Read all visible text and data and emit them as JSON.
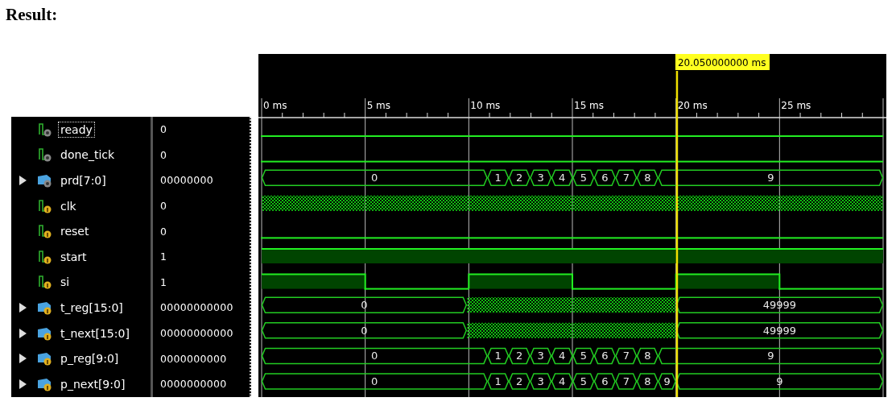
{
  "heading": "Result:",
  "time_axis": {
    "ticks": [
      {
        "label": "0 ms"
      },
      {
        "label": "5 ms"
      },
      {
        "label": "10 ms"
      },
      {
        "label": "15 ms"
      },
      {
        "label": "20 ms"
      },
      {
        "label": "25 ms"
      }
    ]
  },
  "cursor": {
    "label": "20.050000000 ms"
  },
  "signals": [
    {
      "name": "ready",
      "value": "0",
      "kind": "bit",
      "output": true,
      "selected": true,
      "segments": [
        {
          "high": false
        }
      ]
    },
    {
      "name": "done_tick",
      "value": "0",
      "kind": "bit",
      "output": true,
      "selected": false,
      "segments": [
        {
          "high": false
        }
      ]
    },
    {
      "name": "prd[7:0]",
      "value": "00000000",
      "kind": "bus",
      "output": true,
      "selected": false,
      "expanded": false,
      "segments": [
        {
          "kind": "value",
          "value": "0"
        },
        {
          "kind": "value",
          "value": "1"
        },
        {
          "kind": "value",
          "value": "2"
        },
        {
          "kind": "value",
          "value": "3"
        },
        {
          "kind": "value",
          "value": "4"
        },
        {
          "kind": "value",
          "value": "5"
        },
        {
          "kind": "value",
          "value": "6"
        },
        {
          "kind": "value",
          "value": "7"
        },
        {
          "kind": "value",
          "value": "8"
        },
        {
          "kind": "value",
          "value": "9"
        }
      ]
    },
    {
      "name": "clk",
      "value": "0",
      "kind": "clock",
      "output": false,
      "selected": false
    },
    {
      "name": "reset",
      "value": "0",
      "kind": "bit",
      "output": false,
      "selected": false,
      "segments": [
        {
          "high": false
        }
      ]
    },
    {
      "name": "start",
      "value": "1",
      "kind": "bit",
      "output": false,
      "selected": false,
      "segments": [
        {
          "high": true
        }
      ]
    },
    {
      "name": "si",
      "value": "1",
      "kind": "bit",
      "output": false,
      "selected": false,
      "segments": [
        {
          "high": true
        },
        {
          "high": false
        },
        {
          "high": true
        },
        {
          "high": false
        },
        {
          "high": true
        },
        {
          "high": false
        }
      ]
    },
    {
      "name": "t_reg[15:0]",
      "value": "00000000000",
      "kind": "bus",
      "output": false,
      "selected": false,
      "expanded": false,
      "segments": [
        {
          "kind": "value",
          "value": "0"
        },
        {
          "kind": "unknown"
        },
        {
          "kind": "value",
          "value": "49999"
        }
      ]
    },
    {
      "name": "t_next[15:0]",
      "value": "00000000000",
      "kind": "bus",
      "output": false,
      "selected": false,
      "expanded": false,
      "segments": [
        {
          "kind": "value",
          "value": "0"
        },
        {
          "kind": "unknown"
        },
        {
          "kind": "value",
          "value": "49999"
        }
      ]
    },
    {
      "name": "p_reg[9:0]",
      "value": "0000000000",
      "kind": "bus",
      "output": false,
      "selected": false,
      "expanded": false,
      "segments": [
        {
          "kind": "value",
          "value": "0"
        },
        {
          "kind": "value",
          "value": "1"
        },
        {
          "kind": "value",
          "value": "2"
        },
        {
          "kind": "value",
          "value": "3"
        },
        {
          "kind": "value",
          "value": "4"
        },
        {
          "kind": "value",
          "value": "5"
        },
        {
          "kind": "value",
          "value": "6"
        },
        {
          "kind": "value",
          "value": "7"
        },
        {
          "kind": "value",
          "value": "8"
        },
        {
          "kind": "value",
          "value": "9"
        }
      ]
    },
    {
      "name": "p_next[9:0]",
      "value": "0000000000",
      "kind": "bus",
      "output": false,
      "selected": false,
      "expanded": false,
      "segments": [
        {
          "kind": "value",
          "value": "0"
        },
        {
          "kind": "value",
          "value": "1"
        },
        {
          "kind": "value",
          "value": "2"
        },
        {
          "kind": "value",
          "value": "3"
        },
        {
          "kind": "value",
          "value": "4"
        },
        {
          "kind": "value",
          "value": "5"
        },
        {
          "kind": "value",
          "value": "6"
        },
        {
          "kind": "value",
          "value": "7"
        },
        {
          "kind": "value",
          "value": "8"
        },
        {
          "kind": "value",
          "value": "9"
        },
        {
          "kind": "value",
          "value": "9"
        }
      ]
    }
  ]
}
